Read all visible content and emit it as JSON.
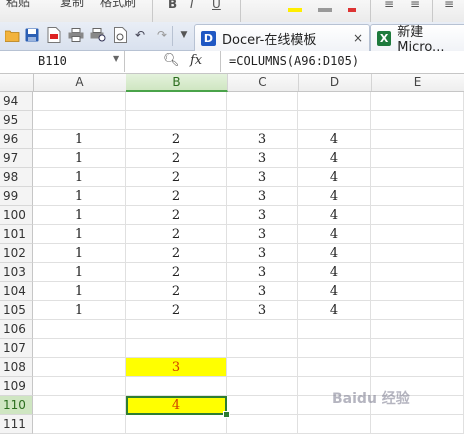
{
  "ribbon": {
    "labels": [
      "粘贴",
      "复制",
      "格式刷"
    ]
  },
  "toolbar": {
    "icons": [
      "open-folder-icon",
      "save-icon",
      "export-pdf-icon",
      "print-icon",
      "print-preview-icon",
      "file-icon",
      "undo-icon",
      "redo-icon",
      "dropdown-arrow-icon"
    ]
  },
  "tabs": [
    {
      "label": "Docer-在线模板",
      "logo": "D",
      "color": "#1f57c3",
      "close": "×"
    },
    {
      "label": "新建 Micro...",
      "logo": "X",
      "color": "#1e7a3c"
    }
  ],
  "namebox": {
    "value": "B110"
  },
  "formula": {
    "fx": "fx",
    "value": "=COLUMNS(A96:D105)"
  },
  "columns": [
    "A",
    "B",
    "C",
    "D",
    "E"
  ],
  "selected_column": "B",
  "selected_row": "110",
  "rows": [
    {
      "num": "94",
      "cells": [
        "",
        "",
        "",
        "",
        ""
      ]
    },
    {
      "num": "95",
      "cells": [
        "",
        "",
        "",
        "",
        ""
      ]
    },
    {
      "num": "96",
      "cells": [
        "1",
        "2",
        "3",
        "4",
        ""
      ]
    },
    {
      "num": "97",
      "cells": [
        "1",
        "2",
        "3",
        "4",
        ""
      ]
    },
    {
      "num": "98",
      "cells": [
        "1",
        "2",
        "3",
        "4",
        ""
      ]
    },
    {
      "num": "99",
      "cells": [
        "1",
        "2",
        "3",
        "4",
        ""
      ]
    },
    {
      "num": "100",
      "cells": [
        "1",
        "2",
        "3",
        "4",
        ""
      ]
    },
    {
      "num": "101",
      "cells": [
        "1",
        "2",
        "3",
        "4",
        ""
      ]
    },
    {
      "num": "102",
      "cells": [
        "1",
        "2",
        "3",
        "4",
        ""
      ]
    },
    {
      "num": "103",
      "cells": [
        "1",
        "2",
        "3",
        "4",
        ""
      ]
    },
    {
      "num": "104",
      "cells": [
        "1",
        "2",
        "3",
        "4",
        ""
      ]
    },
    {
      "num": "105",
      "cells": [
        "1",
        "2",
        "3",
        "4",
        ""
      ]
    },
    {
      "num": "106",
      "cells": [
        "",
        "",
        "",
        "",
        ""
      ]
    },
    {
      "num": "107",
      "cells": [
        "",
        "",
        "",
        "",
        ""
      ]
    },
    {
      "num": "108",
      "cells": [
        "",
        "3",
        "",
        "",
        ""
      ]
    },
    {
      "num": "109",
      "cells": [
        "",
        "",
        "",
        "",
        ""
      ]
    },
    {
      "num": "110",
      "cells": [
        "",
        "4",
        "",
        "",
        ""
      ]
    },
    {
      "num": "111",
      "cells": [
        "",
        "",
        "",
        "",
        ""
      ]
    }
  ],
  "highlight_color": "#ffff00",
  "highlight_text_color": "#d04000",
  "watermark": "Baidu 经验"
}
